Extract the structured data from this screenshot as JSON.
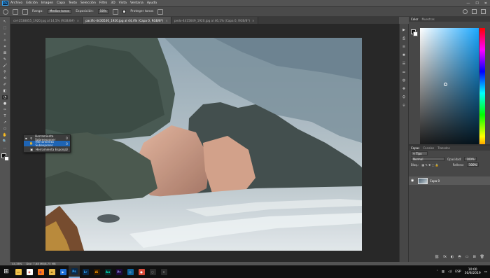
{
  "menubar": {
    "logo": "Ps",
    "items": [
      "Archivo",
      "Edición",
      "Imagen",
      "Capa",
      "Texto",
      "Selección",
      "Filtro",
      "3D",
      "Vista",
      "Ventana",
      "Ayuda"
    ],
    "window_controls": [
      "—",
      "☐",
      "✕"
    ]
  },
  "options": {
    "range_label": "Rango:",
    "range_value": "Medios tonos",
    "exposure_label": "Exposición:",
    "exposure_value": "50%",
    "protect_label": "Proteger tonos"
  },
  "tabs": [
    {
      "label": "cel-2538855_1920.jpg al 14,5% (RGB/8#)"
    },
    {
      "label": "pacific-4430530_1920.jpg al 44,4% (Capa 0, RGB/8*)",
      "active": true
    },
    {
      "label": "pedo-4415649_1920.jpg al 46,1% (Capa 0, RGB/8*)"
    }
  ],
  "tools": [
    "↖",
    "⬚",
    "⌁",
    "✧",
    "⌗",
    "⊠",
    "✎",
    "🖌",
    "⚲",
    "⟲",
    "✐",
    "◧",
    "◔",
    "●",
    "✑",
    "T",
    "↗",
    "▭",
    "✋",
    "🔍",
    "…"
  ],
  "flyout": {
    "items": [
      {
        "label": "Herramienta Sobreexponer",
        "key": "O"
      },
      {
        "label": "Herramienta Subexponer",
        "key": "O"
      },
      {
        "label": "Herramienta Esponja",
        "key": "O"
      }
    ]
  },
  "status": {
    "zoom": "44,38%",
    "doc": "Doc: 7,68 MB/8,75 MB"
  },
  "right_icons": [
    "▶",
    "⎙",
    "≡",
    "✺",
    "☰",
    "⚌",
    "◍",
    "❖",
    "⛭",
    "⌾"
  ],
  "color_panel": {
    "tabs": [
      "Color",
      "Muestras"
    ]
  },
  "layers_panel": {
    "tabs": [
      "Capas",
      "Canales",
      "Trazados"
    ],
    "kind_label": "Tipo",
    "blend_mode": "Normal",
    "opacity_label": "Opacidad:",
    "opacity_value": "100%",
    "lock_label": "Bloq.:",
    "fill_label": "Relleno:",
    "fill_value": "100%",
    "layer_name": "Capa 0",
    "bottom_icons": [
      "⛓",
      "fx",
      "◐",
      "◓",
      "▭",
      "⊞",
      "🗑"
    ]
  },
  "taskbar": {
    "start": "⊞",
    "apps": [
      {
        "name": "explorer",
        "glyph": "▭",
        "color": "#f2c24b",
        "fg": "#5a3b00"
      },
      {
        "name": "chrome",
        "glyph": "◉",
        "color": "#ffffff",
        "fg": "#db4437"
      },
      {
        "name": "firefox",
        "glyph": "◐",
        "color": "#ff7a1a",
        "fg": "#5a2a9a"
      },
      {
        "name": "folder",
        "glyph": "▰",
        "color": "#e8b84a",
        "fg": "#6a4a00"
      },
      {
        "name": "media",
        "glyph": "▶",
        "color": "#1e6fd6",
        "fg": "#ffffff"
      },
      {
        "name": "photoshop",
        "glyph": "Ps",
        "color": "#0b2a4a",
        "fg": "#31a8ff",
        "active": true
      },
      {
        "name": "lightroom",
        "glyph": "Lr",
        "color": "#0b2a4a",
        "fg": "#31a8ff"
      },
      {
        "name": "illustrator",
        "glyph": "Ai",
        "color": "#2e1a00",
        "fg": "#ff9a00"
      },
      {
        "name": "audition",
        "glyph": "Au",
        "color": "#0b2b2a",
        "fg": "#00e4bb"
      },
      {
        "name": "premiere",
        "glyph": "Pr",
        "color": "#1f0a3a",
        "fg": "#9999ff"
      },
      {
        "name": "vscode",
        "glyph": "◇",
        "color": "#0e639c",
        "fg": "#ffffff"
      },
      {
        "name": "app12",
        "glyph": "●",
        "color": "#d84a3a",
        "fg": "#ffffff"
      },
      {
        "name": "app13",
        "glyph": "◌",
        "color": "#2b2b2b",
        "fg": "#dddddd"
      },
      {
        "name": "app14",
        "glyph": "✕",
        "color": "#2b2b2b",
        "fg": "#aaaaaa"
      }
    ],
    "tray": {
      "lang": "ESP",
      "time": "10:00",
      "date": "30/8/2019"
    }
  }
}
